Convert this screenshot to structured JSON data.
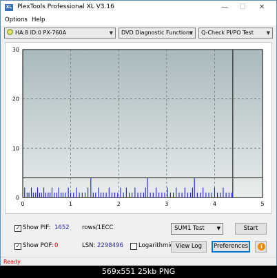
{
  "window": {
    "title": "PlexTools Professional XL V3.16",
    "icon_label": "XL"
  },
  "title_buttons": {
    "minimize": "—",
    "maximize": "☐",
    "close": "✕"
  },
  "menu": {
    "options": "Options",
    "help": "Help"
  },
  "toolbar": {
    "drive": "HA:8 ID:0  PX-760A",
    "function": "DVD Diagnostic Functions",
    "test": "Q-Check PI/PO Test",
    "arrow": "▼"
  },
  "chart_data": {
    "type": "bar",
    "x_ticks": [
      "0",
      "1",
      "2",
      "3",
      "4",
      "5"
    ],
    "y_ticks": [
      "0",
      "10",
      "20",
      "30"
    ],
    "xlim": [
      0,
      5
    ],
    "ylim": [
      0,
      30
    ],
    "threshold": 4,
    "end_marker_x": 4.38,
    "grid": true,
    "colors": {
      "bars": "#0000ff",
      "background_top": "#a9b9bd",
      "background_bottom": "#e9eded",
      "grid": "#6e7a7a",
      "threshold": "#000000"
    },
    "x": [
      0.04,
      0.09,
      0.13,
      0.18,
      0.22,
      0.27,
      0.31,
      0.35,
      0.39,
      0.44,
      0.48,
      0.53,
      0.57,
      0.61,
      0.66,
      0.71,
      0.75,
      0.8,
      0.84,
      0.89,
      0.95,
      1.0,
      1.06,
      1.12,
      1.18,
      1.24,
      1.3,
      1.36,
      1.42,
      1.47,
      1.52,
      1.58,
      1.63,
      1.68,
      1.74,
      1.8,
      1.86,
      1.92,
      1.98,
      2.04,
      2.1,
      2.16,
      2.22,
      2.28,
      2.34,
      2.4,
      2.46,
      2.52,
      2.56,
      2.6,
      2.66,
      2.72,
      2.78,
      2.84,
      2.9,
      2.96,
      3.02,
      3.08,
      3.14,
      3.2,
      3.26,
      3.32,
      3.38,
      3.44,
      3.5,
      3.54,
      3.58,
      3.64,
      3.7,
      3.76,
      3.82,
      3.88,
      3.94,
      4.0,
      4.06,
      4.12,
      4.18,
      4.24,
      4.3,
      4.36
    ],
    "values": [
      2,
      1,
      1,
      2,
      1,
      1,
      2,
      1,
      1,
      2,
      1,
      1,
      1,
      2,
      1,
      1,
      2,
      1,
      1,
      1,
      2,
      1,
      1,
      2,
      1,
      1,
      1,
      2,
      4,
      1,
      1,
      2,
      1,
      1,
      1,
      2,
      1,
      1,
      1,
      2,
      1,
      2,
      1,
      1,
      2,
      1,
      1,
      1,
      2,
      4,
      1,
      1,
      2,
      1,
      1,
      1,
      2,
      1,
      1,
      2,
      1,
      1,
      2,
      1,
      1,
      2,
      4,
      1,
      1,
      2,
      1,
      1,
      1,
      2,
      1,
      1,
      2,
      1,
      1,
      1
    ]
  },
  "controls": {
    "pif_label": "Show PIF:",
    "pif_value": "1652",
    "pif_unit": "rows/1ECC",
    "pof_label": "Show POF:",
    "pof_value": "0",
    "lsn_label": "LSN:",
    "lsn_value": "2298496",
    "log_label": "Logarithmic",
    "sum_select": "SUM1 Test",
    "start": "Start",
    "view_log": "View Log",
    "preferences": "Preferences",
    "info": "i",
    "check_mark": "✓"
  },
  "status": {
    "text": "Ready"
  },
  "caption": {
    "text": "569x551  25kb  PNG"
  }
}
